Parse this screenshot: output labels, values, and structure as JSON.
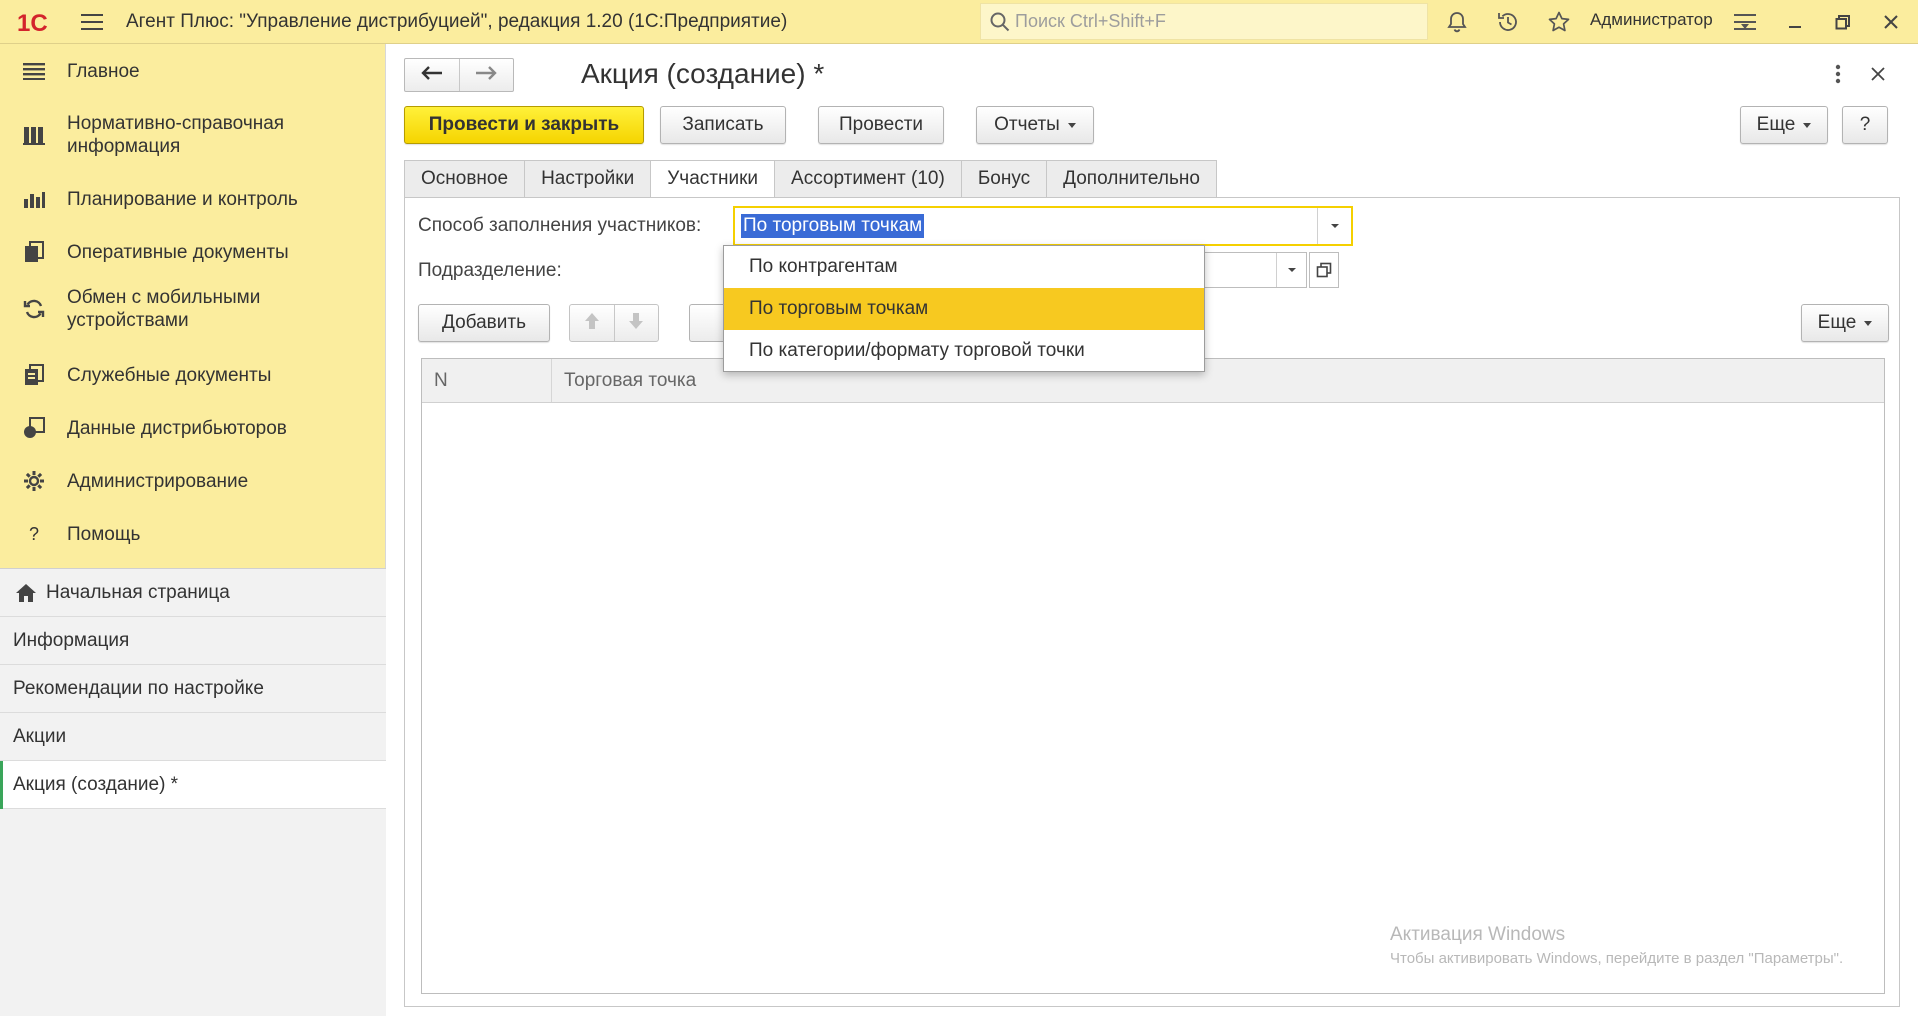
{
  "app": {
    "logo_text": "1С",
    "title": "Агент Плюс: \"Управление дистрибуцией\", редакция 1.20  (1С:Предприятие)",
    "search_placeholder": "Поиск Ctrl+Shift+F",
    "user": "Администратор"
  },
  "sidebar": {
    "sections": [
      {
        "label": "Главное",
        "icon": "menu-lines-icon"
      },
      {
        "label": "Нормативно-справочная информация",
        "icon": "reference-books-icon"
      },
      {
        "label": "Планирование и контроль",
        "icon": "bar-chart-icon"
      },
      {
        "label": "Оперативные документы",
        "icon": "documents-icon"
      },
      {
        "label": "Обмен с мобильными устройствами",
        "icon": "sync-icon"
      },
      {
        "label": "Служебные документы",
        "icon": "service-documents-icon"
      },
      {
        "label": "Данные дистрибьюторов",
        "icon": "distributor-data-icon"
      },
      {
        "label": "Администрирование",
        "icon": "gear-icon"
      },
      {
        "label": "Помощь",
        "icon": "help-icon"
      }
    ],
    "open_windows": [
      {
        "label": "Начальная страница",
        "icon": "home-icon"
      },
      {
        "label": "Информация"
      },
      {
        "label": "Рекомендации по настройке"
      },
      {
        "label": "Акции"
      },
      {
        "label": "Акция (создание) *",
        "active": true
      }
    ]
  },
  "form": {
    "title": "Акция (создание) *",
    "toolbar": {
      "post_close": "Провести и закрыть",
      "save": "Записать",
      "post": "Провести",
      "reports": "Отчеты",
      "more": "Еще",
      "help": "?"
    },
    "tabs": [
      {
        "label": "Основное"
      },
      {
        "label": "Настройки"
      },
      {
        "label": "Участники",
        "active": true
      },
      {
        "label": "Ассортимент (10)"
      },
      {
        "label": "Бонус"
      },
      {
        "label": "Дополнительно"
      }
    ],
    "fill_method_label": "Способ заполнения участников:",
    "fill_method_value": "По торговым точкам",
    "division_label": "Подразделение:",
    "add_button": "Добавить",
    "table_more": "Еще",
    "table_columns": [
      "N",
      "Торговая точка"
    ],
    "dropdown_options": [
      {
        "label": "По контрагентам"
      },
      {
        "label": "По торговым точкам",
        "selected": true
      },
      {
        "label": "По категории/формату торговой точки"
      }
    ]
  },
  "watermark": {
    "title": "Активация Windows",
    "subtitle": "Чтобы активировать Windows, перейдите в раздел \"Параметры\"."
  },
  "colors": {
    "accent_yellow": "#fbed9e",
    "primary_button": "#f5d400",
    "selected_option": "#f7c920",
    "text_selection": "#3a6bd6",
    "active_marker": "#3aa55a"
  }
}
